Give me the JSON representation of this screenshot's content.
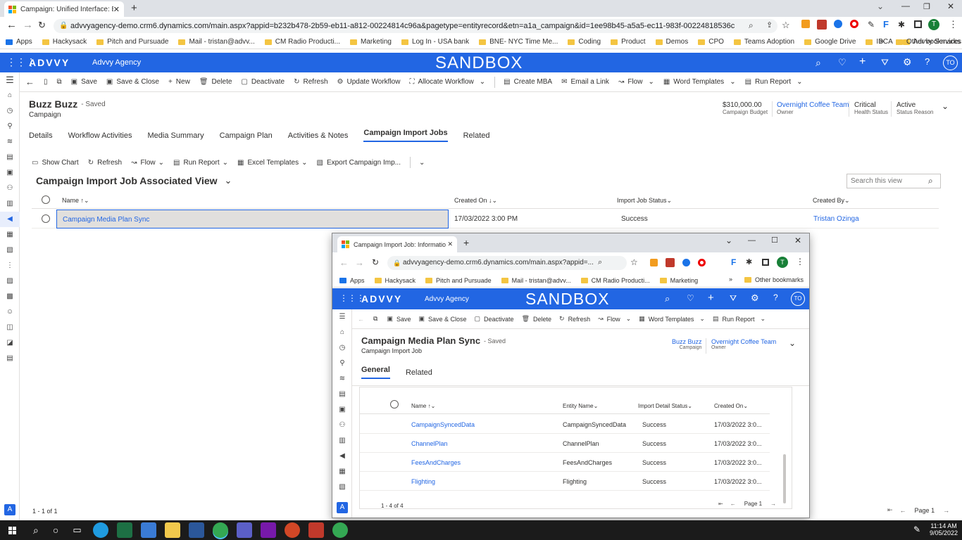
{
  "browser": {
    "tab_title": "Campaign: Unified Interface: Buzz",
    "url": "advvyagency-demo.crm6.dynamics.com/main.aspx?appid=b232b478-2b59-eb11-a812-00224814c96a&pagetype=entityrecord&etn=a1a_campaign&id=1ee98b45-a5a5-ec11-983f-00224818536c",
    "profile_initial": "T",
    "bookmarks": [
      "Apps",
      "Hackysack",
      "Pitch and Pursuade",
      "Mail - tristan@advv...",
      "CM Radio Producti...",
      "Marketing",
      "Log In - USA bank",
      "BNE- NYC Time Me...",
      "Coding",
      "Product",
      "Demos",
      "CPO",
      "Teams Adoption",
      "Google Drive",
      "IBCA",
      "Advvy Services"
    ],
    "other_bookmarks": "Other bookmarks"
  },
  "app": {
    "logo": "ADVVY",
    "org": "Advvy Agency",
    "env": "SANDBOX",
    "user_initials": "TO",
    "accent": "#2266e3"
  },
  "cmdbar": [
    "Save",
    "Save & Close",
    "New",
    "Delete",
    "Deactivate",
    "Refresh",
    "Update Workflow",
    "Allocate Workflow",
    "Create MBA",
    "Email a Link",
    "Flow",
    "Word Templates",
    "Run Report"
  ],
  "record": {
    "title": "Buzz Buzz",
    "saved": "- Saved",
    "entity": "Campaign",
    "budget_value": "$310,000.00",
    "budget_label": "Campaign Budget",
    "owner_value": "Overnight Coffee Team",
    "owner_label": "Owner",
    "health_value": "Critical",
    "health_label": "Health Status",
    "status_value": "Active",
    "status_label": "Status Reason",
    "tabs": [
      "Details",
      "Workflow Activities",
      "Media Summary",
      "Campaign Plan",
      "Activities & Notes",
      "Campaign Import Jobs",
      "Related"
    ]
  },
  "subgrid": {
    "toolbar": [
      "Show Chart",
      "Refresh",
      "Flow",
      "Run Report",
      "Excel Templates",
      "Export Campaign Imp..."
    ],
    "view_title": "Campaign Import Job Associated View",
    "search_placeholder": "Search this view",
    "columns": [
      "Name",
      "Created On",
      "Import Job Status",
      "Created By"
    ],
    "rows": [
      {
        "name": "Campaign Media Plan Sync",
        "created_on": "17/03/2022 3:00 PM",
        "status": "Success",
        "created_by": "Tristan Ozinga"
      }
    ],
    "count": "1 - 1 of 1",
    "page": "Page 1"
  },
  "popup": {
    "tab_title": "Campaign Import Job: Informatio",
    "url": "advvyagency-demo.crm6.dynamics.com/main.aspx?appid=...",
    "bookmarks": [
      "Apps",
      "Hackysack",
      "Pitch and Pursuade",
      "Mail - tristan@advv...",
      "CM Radio Producti...",
      "Marketing"
    ],
    "other_bookmarks": "Other bookmarks",
    "cmdbar": [
      "Save",
      "Save & Close",
      "Deactivate",
      "Delete",
      "Refresh",
      "Flow",
      "Word Templates",
      "Run Report"
    ],
    "title": "Campaign Media Plan Sync",
    "saved": "- Saved",
    "entity": "Campaign Import Job",
    "campaign_value": "Buzz Buzz",
    "campaign_label": "Campaign",
    "owner_value": "Overnight Coffee Team",
    "owner_label": "Owner",
    "tabs": [
      "General",
      "Related"
    ],
    "columns": [
      "Name",
      "Entity Name",
      "Import Detail Status",
      "Created On"
    ],
    "rows": [
      {
        "name": "CampaignSyncedData",
        "entity": "CampaignSyncedData",
        "status": "Success",
        "created": "17/03/2022 3:0..."
      },
      {
        "name": "ChannelPlan",
        "entity": "ChannelPlan",
        "status": "Success",
        "created": "17/03/2022 3:0..."
      },
      {
        "name": "FeesAndCharges",
        "entity": "FeesAndCharges",
        "status": "Success",
        "created": "17/03/2022 3:0..."
      },
      {
        "name": "Flighting",
        "entity": "Flighting",
        "status": "Success",
        "created": "17/03/2022 3:0..."
      }
    ],
    "count": "1 - 4 of 4",
    "page": "Page 1"
  },
  "taskbar": {
    "time": "11:14 AM",
    "date": "9/05/2022"
  }
}
